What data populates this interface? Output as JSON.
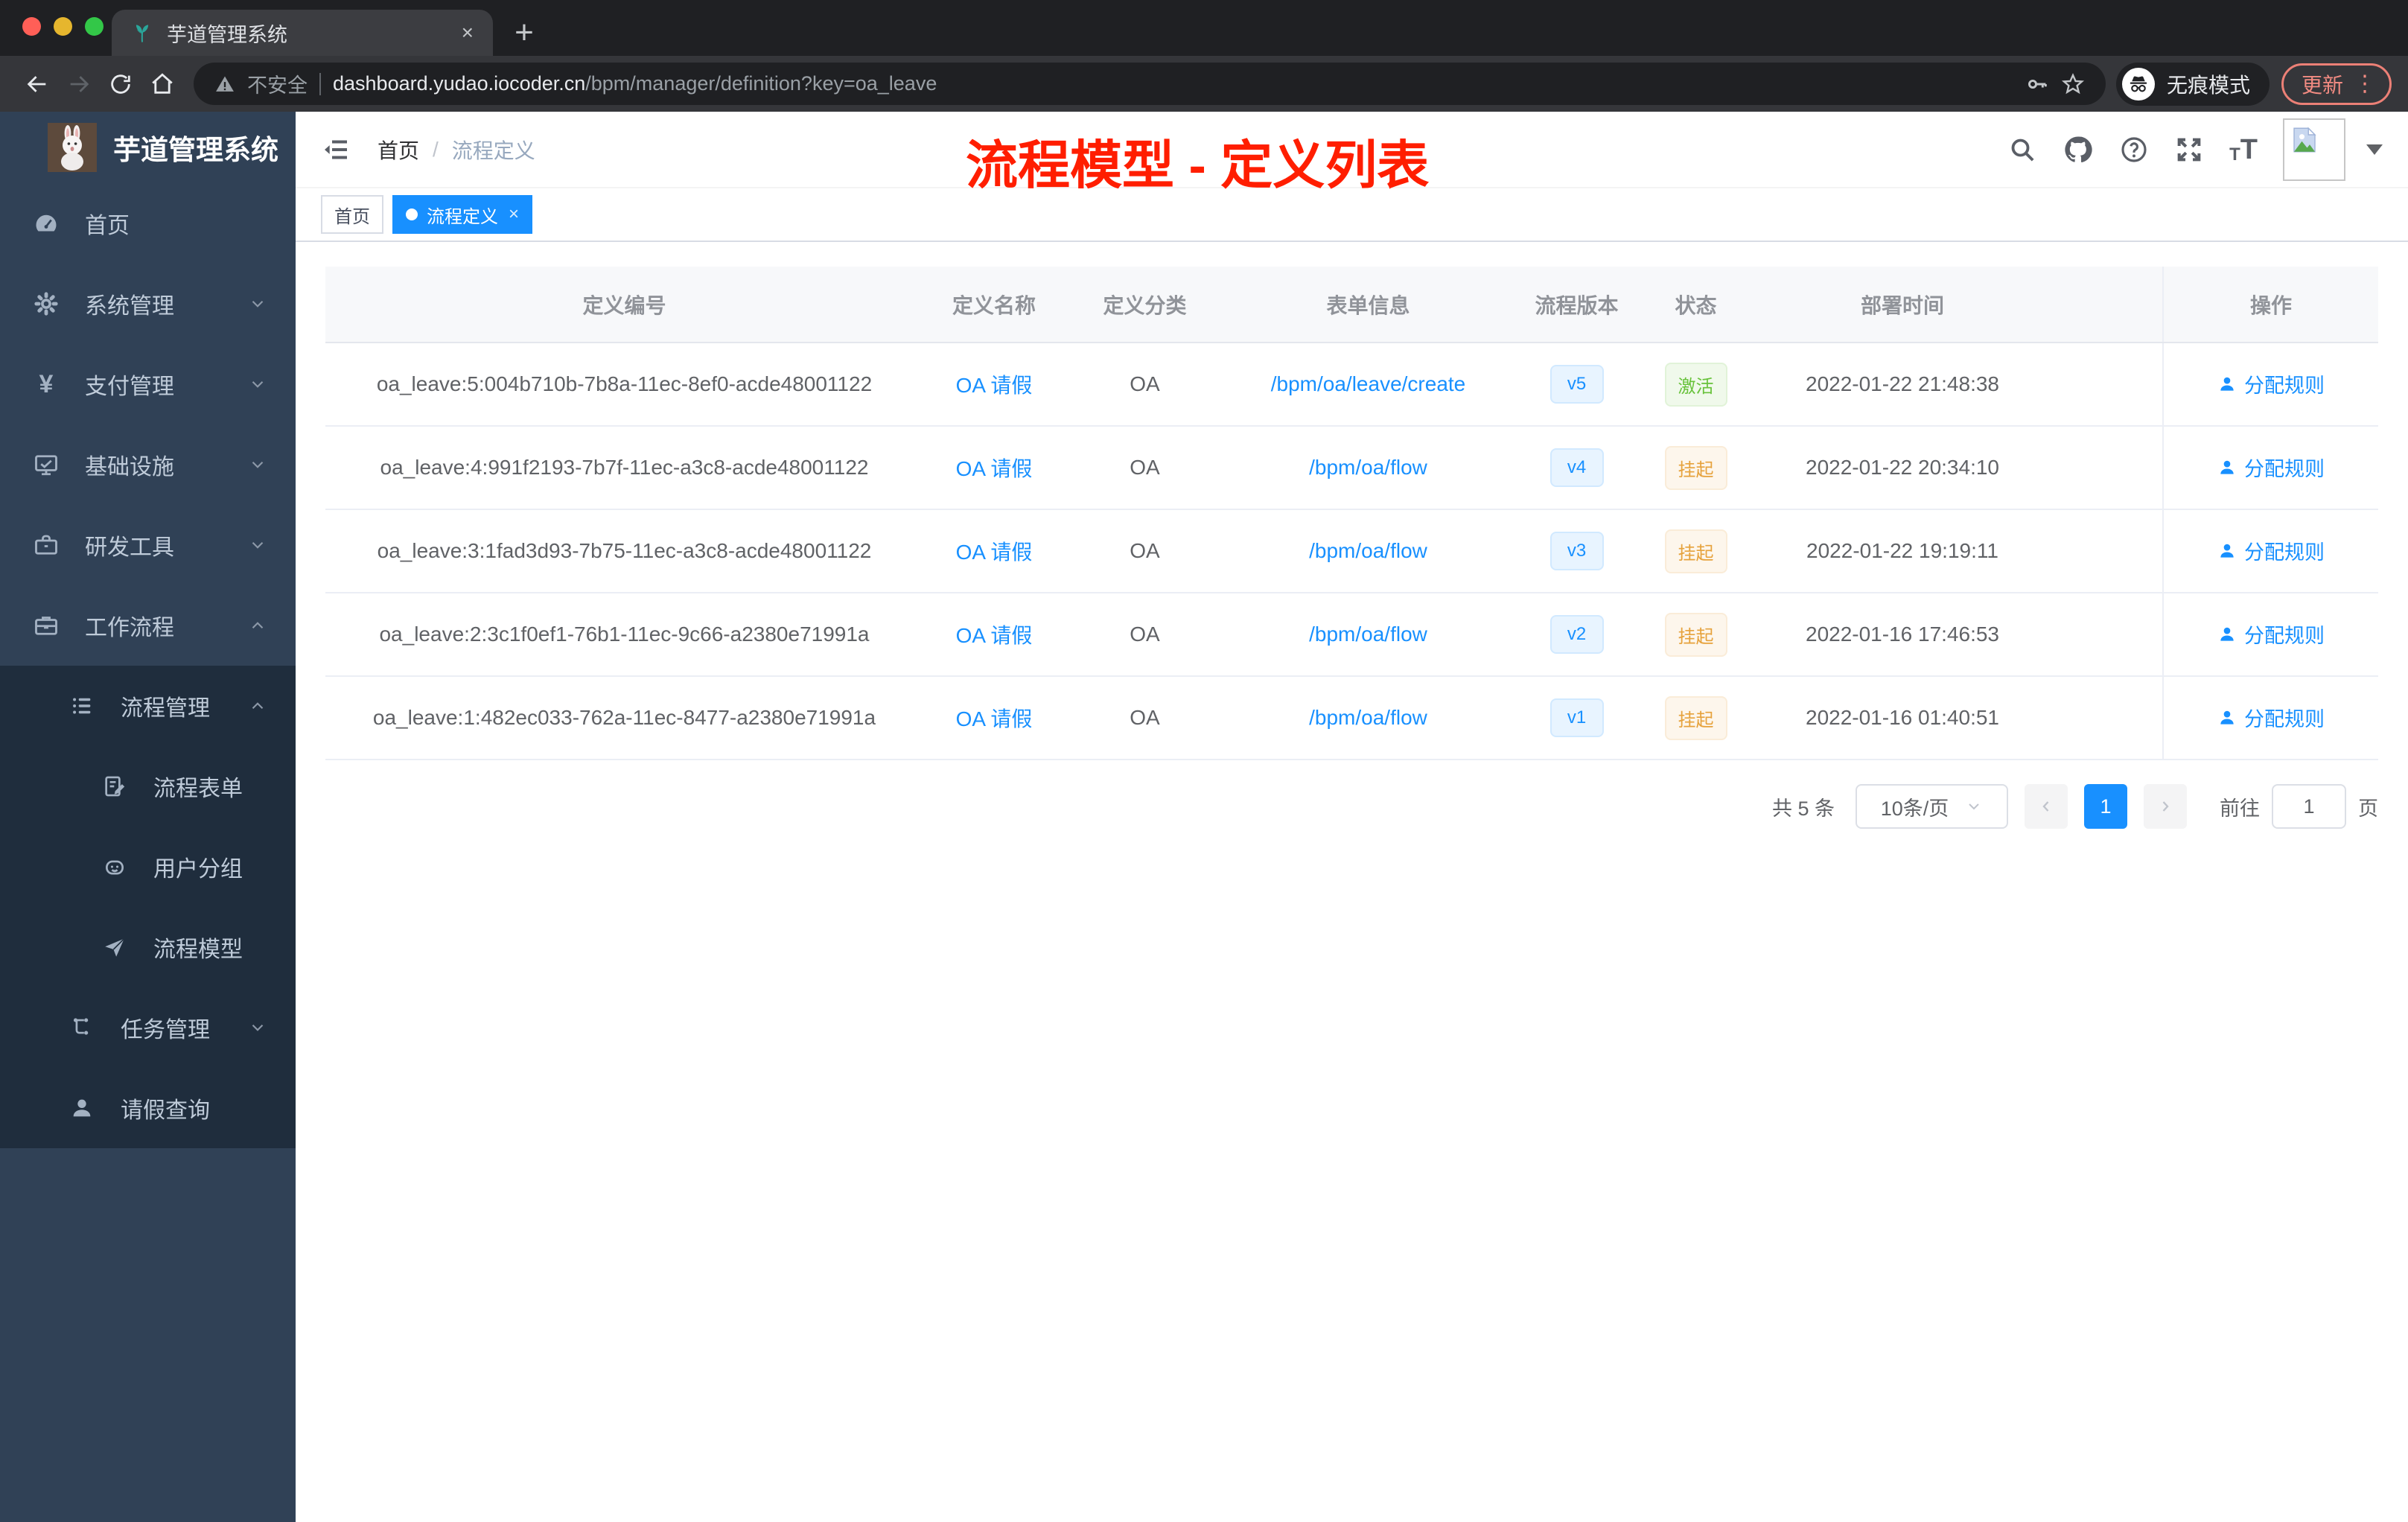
{
  "colors": {
    "accent": "#1890ff",
    "annotation_red": "#ff1e00",
    "success": "#67c23a",
    "warning": "#e6a23c",
    "sidebar_bg": "#304156",
    "submenu_bg": "#1f2d3d"
  },
  "browser": {
    "tab_title": "芋道管理系统",
    "tab_close": "×",
    "new_tab": "+",
    "not_secure": "不安全",
    "url_host": "dashboard.yudao.iocoder.cn",
    "url_path": "/bpm/manager/definition?key=oa_leave",
    "incognito_label": "无痕模式",
    "update_label": "更新",
    "kebab": "⋮"
  },
  "sidebar": {
    "logo_title": "芋道管理系统",
    "items": [
      {
        "label": "首页",
        "icon": "dashboard-icon"
      },
      {
        "label": "系统管理",
        "icon": "gear-icon",
        "chevron": "down"
      },
      {
        "label": "支付管理",
        "icon": "yen-icon",
        "chevron": "down"
      },
      {
        "label": "基础设施",
        "icon": "monitor-icon",
        "chevron": "down"
      },
      {
        "label": "研发工具",
        "icon": "toolbox-icon",
        "chevron": "down"
      },
      {
        "label": "工作流程",
        "icon": "briefcase-icon",
        "chevron": "up"
      },
      {
        "label": "流程管理",
        "icon": "tree-list-icon",
        "chevron": "up"
      },
      {
        "label": "流程表单",
        "icon": "form-edit-icon"
      },
      {
        "label": "用户分组",
        "icon": "robot-icon"
      },
      {
        "label": "流程模型",
        "icon": "paper-plane-icon"
      },
      {
        "label": "任务管理",
        "icon": "org-tree-icon",
        "chevron": "down"
      },
      {
        "label": "请假查询",
        "icon": "user-icon"
      }
    ]
  },
  "header": {
    "breadcrumb_home": "首页",
    "breadcrumb_sep": "/",
    "breadcrumb_current": "流程定义",
    "annotation": "流程模型 - 定义列表"
  },
  "tags": {
    "home": "首页",
    "active_label": "流程定义",
    "close": "×"
  },
  "table": {
    "columns": {
      "id": "定义编号",
      "name": "定义名称",
      "category": "定义分类",
      "form": "表单信息",
      "version": "流程版本",
      "status": "状态",
      "deploy_time": "部署时间",
      "actions": "操作"
    },
    "action_label": "分配规则",
    "rows": [
      {
        "id": "oa_leave:5:004b710b-7b8a-11ec-8ef0-acde48001122",
        "name": "OA 请假",
        "category": "OA",
        "form": "/bpm/oa/leave/create",
        "version": "v5",
        "status": "激活",
        "status_type": "success",
        "deploy_time": "2022-01-22 21:48:38"
      },
      {
        "id": "oa_leave:4:991f2193-7b7f-11ec-a3c8-acde48001122",
        "name": "OA 请假",
        "category": "OA",
        "form": "/bpm/oa/flow",
        "version": "v4",
        "status": "挂起",
        "status_type": "warning",
        "deploy_time": "2022-01-22 20:34:10"
      },
      {
        "id": "oa_leave:3:1fad3d93-7b75-11ec-a3c8-acde48001122",
        "name": "OA 请假",
        "category": "OA",
        "form": "/bpm/oa/flow",
        "version": "v3",
        "status": "挂起",
        "status_type": "warning",
        "deploy_time": "2022-01-22 19:19:11"
      },
      {
        "id": "oa_leave:2:3c1f0ef1-76b1-11ec-9c66-a2380e71991a",
        "name": "OA 请假",
        "category": "OA",
        "form": "/bpm/oa/flow",
        "version": "v2",
        "status": "挂起",
        "status_type": "warning",
        "deploy_time": "2022-01-16 17:46:53"
      },
      {
        "id": "oa_leave:1:482ec033-762a-11ec-8477-a2380e71991a",
        "name": "OA 请假",
        "category": "OA",
        "form": "/bpm/oa/flow",
        "version": "v1",
        "status": "挂起",
        "status_type": "warning",
        "deploy_time": "2022-01-16 01:40:51"
      }
    ]
  },
  "pagination": {
    "total": "共 5 条",
    "page_size": "10条/页",
    "prev": "‹",
    "current_page": "1",
    "next": "›",
    "goto_label": "前往",
    "goto_value": "1",
    "page_unit": "页"
  }
}
